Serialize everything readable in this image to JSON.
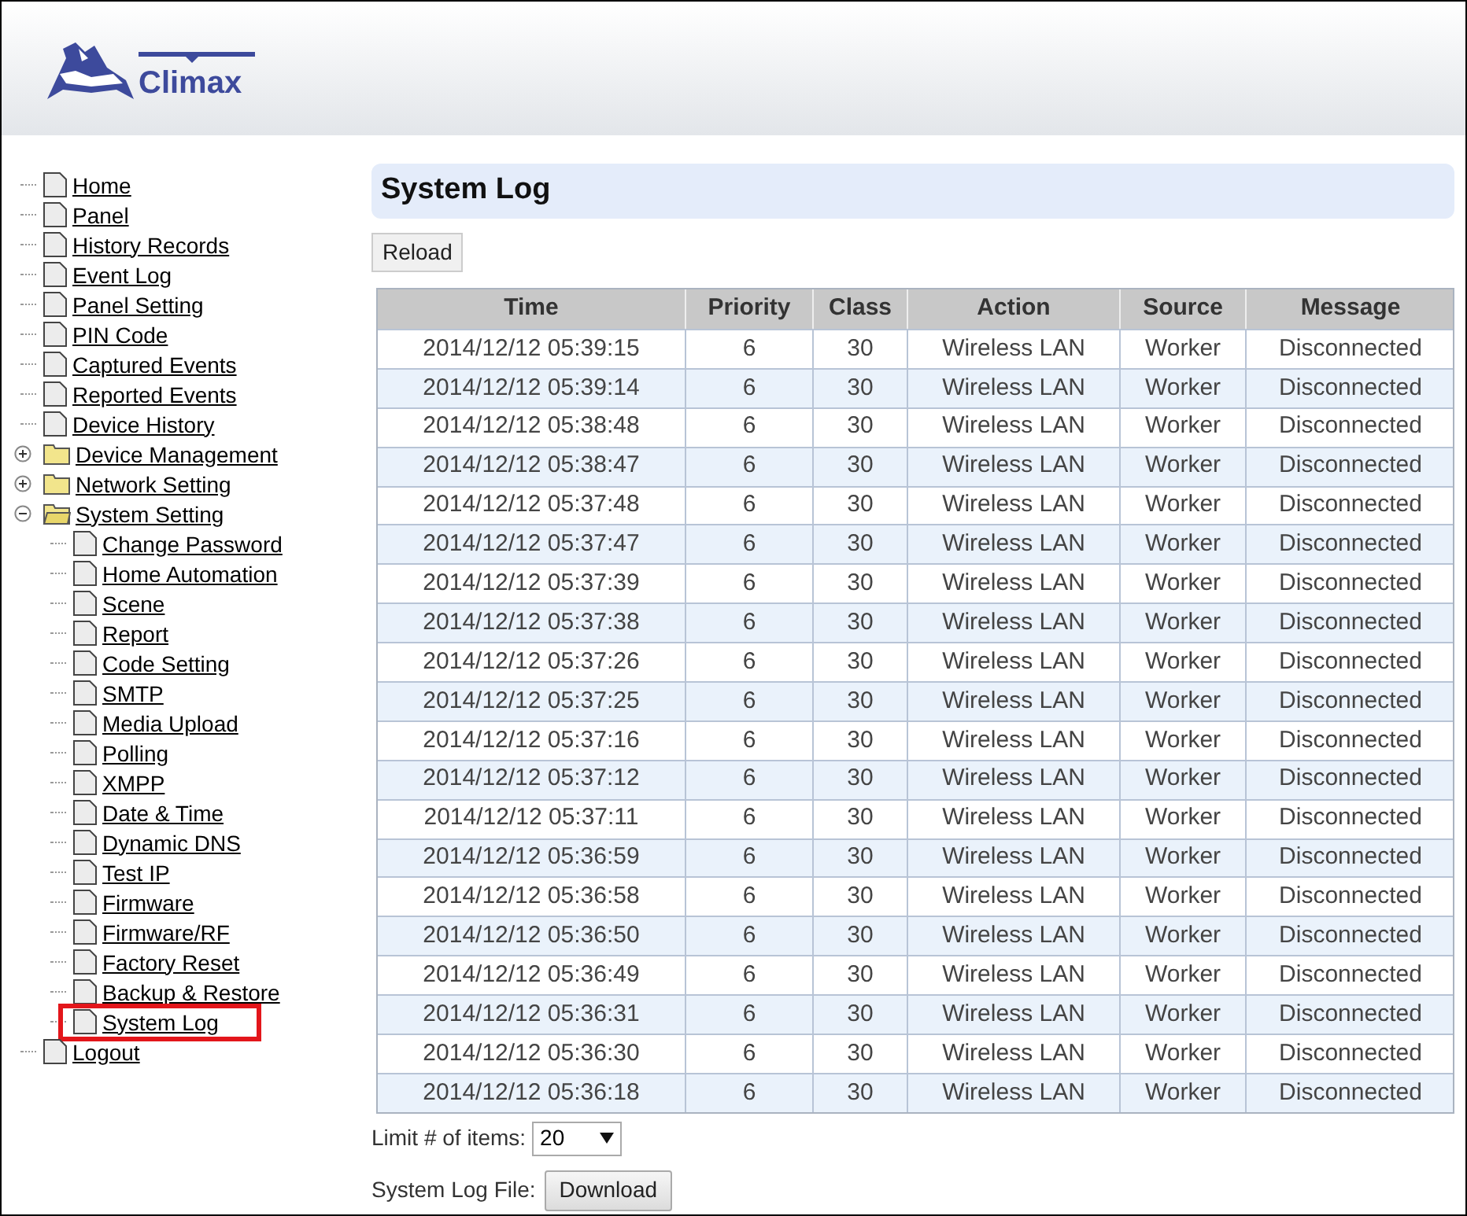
{
  "header": {
    "logo_text": "Climax"
  },
  "sidebar": {
    "items": [
      {
        "label": "Home",
        "kind": "page",
        "selected": false
      },
      {
        "label": "Panel",
        "kind": "page",
        "selected": false
      },
      {
        "label": "History Records",
        "kind": "page",
        "selected": false
      },
      {
        "label": "Event Log",
        "kind": "page",
        "selected": false
      },
      {
        "label": "Panel Setting",
        "kind": "page",
        "selected": false
      },
      {
        "label": "PIN Code",
        "kind": "page",
        "selected": false
      },
      {
        "label": "Captured Events",
        "kind": "page",
        "selected": false
      },
      {
        "label": "Reported Events",
        "kind": "page",
        "selected": false
      },
      {
        "label": "Device History",
        "kind": "page",
        "selected": false
      },
      {
        "label": "Device Management",
        "kind": "folder",
        "expanded": false,
        "selected": false
      },
      {
        "label": "Network Setting",
        "kind": "folder",
        "expanded": false,
        "selected": false
      },
      {
        "label": "System Setting",
        "kind": "folder",
        "expanded": true,
        "selected": false,
        "children": [
          {
            "label": "Change Password",
            "kind": "page",
            "selected": false
          },
          {
            "label": "Home Automation",
            "kind": "page",
            "selected": false
          },
          {
            "label": "Scene",
            "kind": "page",
            "selected": false
          },
          {
            "label": "Report",
            "kind": "page",
            "selected": false
          },
          {
            "label": "Code Setting",
            "kind": "page",
            "selected": false
          },
          {
            "label": "SMTP",
            "kind": "page",
            "selected": false
          },
          {
            "label": "Media Upload",
            "kind": "page",
            "selected": false
          },
          {
            "label": "Polling",
            "kind": "page",
            "selected": false
          },
          {
            "label": "XMPP",
            "kind": "page",
            "selected": false
          },
          {
            "label": "Date & Time",
            "kind": "page",
            "selected": false
          },
          {
            "label": "Dynamic DNS",
            "kind": "page",
            "selected": false
          },
          {
            "label": "Test IP",
            "kind": "page",
            "selected": false
          },
          {
            "label": "Firmware",
            "kind": "page",
            "selected": false
          },
          {
            "label": "Firmware/RF",
            "kind": "page",
            "selected": false
          },
          {
            "label": "Factory Reset",
            "kind": "page",
            "selected": false
          },
          {
            "label": "Backup & Restore",
            "kind": "page",
            "selected": false
          },
          {
            "label": "System Log",
            "kind": "page",
            "selected": true
          }
        ]
      },
      {
        "label": "Logout",
        "kind": "page",
        "selected": false
      }
    ]
  },
  "page_title": "System Log",
  "reload_button": "Reload",
  "table": {
    "columns": [
      "Time",
      "Priority",
      "Class",
      "Action",
      "Source",
      "Message"
    ],
    "rows": [
      [
        "2014/12/12 05:39:15",
        "6",
        "30",
        "Wireless LAN",
        "Worker",
        "Disconnected"
      ],
      [
        "2014/12/12 05:39:14",
        "6",
        "30",
        "Wireless LAN",
        "Worker",
        "Disconnected"
      ],
      [
        "2014/12/12 05:38:48",
        "6",
        "30",
        "Wireless LAN",
        "Worker",
        "Disconnected"
      ],
      [
        "2014/12/12 05:38:47",
        "6",
        "30",
        "Wireless LAN",
        "Worker",
        "Disconnected"
      ],
      [
        "2014/12/12 05:37:48",
        "6",
        "30",
        "Wireless LAN",
        "Worker",
        "Disconnected"
      ],
      [
        "2014/12/12 05:37:47",
        "6",
        "30",
        "Wireless LAN",
        "Worker",
        "Disconnected"
      ],
      [
        "2014/12/12 05:37:39",
        "6",
        "30",
        "Wireless LAN",
        "Worker",
        "Disconnected"
      ],
      [
        "2014/12/12 05:37:38",
        "6",
        "30",
        "Wireless LAN",
        "Worker",
        "Disconnected"
      ],
      [
        "2014/12/12 05:37:26",
        "6",
        "30",
        "Wireless LAN",
        "Worker",
        "Disconnected"
      ],
      [
        "2014/12/12 05:37:25",
        "6",
        "30",
        "Wireless LAN",
        "Worker",
        "Disconnected"
      ],
      [
        "2014/12/12 05:37:16",
        "6",
        "30",
        "Wireless LAN",
        "Worker",
        "Disconnected"
      ],
      [
        "2014/12/12 05:37:12",
        "6",
        "30",
        "Wireless LAN",
        "Worker",
        "Disconnected"
      ],
      [
        "2014/12/12 05:37:11",
        "6",
        "30",
        "Wireless LAN",
        "Worker",
        "Disconnected"
      ],
      [
        "2014/12/12 05:36:59",
        "6",
        "30",
        "Wireless LAN",
        "Worker",
        "Disconnected"
      ],
      [
        "2014/12/12 05:36:58",
        "6",
        "30",
        "Wireless LAN",
        "Worker",
        "Disconnected"
      ],
      [
        "2014/12/12 05:36:50",
        "6",
        "30",
        "Wireless LAN",
        "Worker",
        "Disconnected"
      ],
      [
        "2014/12/12 05:36:49",
        "6",
        "30",
        "Wireless LAN",
        "Worker",
        "Disconnected"
      ],
      [
        "2014/12/12 05:36:31",
        "6",
        "30",
        "Wireless LAN",
        "Worker",
        "Disconnected"
      ],
      [
        "2014/12/12 05:36:30",
        "6",
        "30",
        "Wireless LAN",
        "Worker",
        "Disconnected"
      ],
      [
        "2014/12/12 05:36:18",
        "6",
        "30",
        "Wireless LAN",
        "Worker",
        "Disconnected"
      ]
    ]
  },
  "limit": {
    "label": "Limit # of items:",
    "value": "20"
  },
  "log_file": {
    "label": "System Log File:",
    "button": "Download"
  }
}
